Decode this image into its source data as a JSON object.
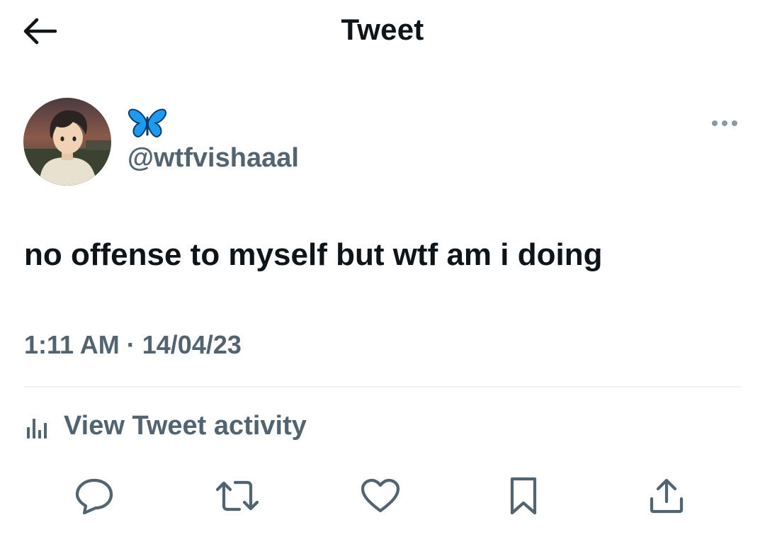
{
  "header": {
    "title": "Tweet",
    "back_icon": "arrow-left-icon"
  },
  "author": {
    "display_name_emoji": "butterfly-icon",
    "handle": "@wtfvishaaal",
    "avatar": "avatar-illustration",
    "more_icon": "more-dots-icon"
  },
  "tweet": {
    "text": "no offense to myself but wtf am i doing",
    "time": "1:11 AM",
    "separator": "·",
    "date": "14/04/23"
  },
  "activity": {
    "label": "View Tweet activity",
    "icon": "analytics-icon"
  },
  "actions": {
    "reply_icon": "reply-icon",
    "retweet_icon": "retweet-icon",
    "like_icon": "like-icon",
    "bookmark_icon": "bookmark-icon",
    "share_icon": "share-icon"
  },
  "colors": {
    "text_primary": "#0f1419",
    "text_secondary": "#536471",
    "divider": "#eff3f4",
    "butterfly": "#1d9bf0"
  }
}
